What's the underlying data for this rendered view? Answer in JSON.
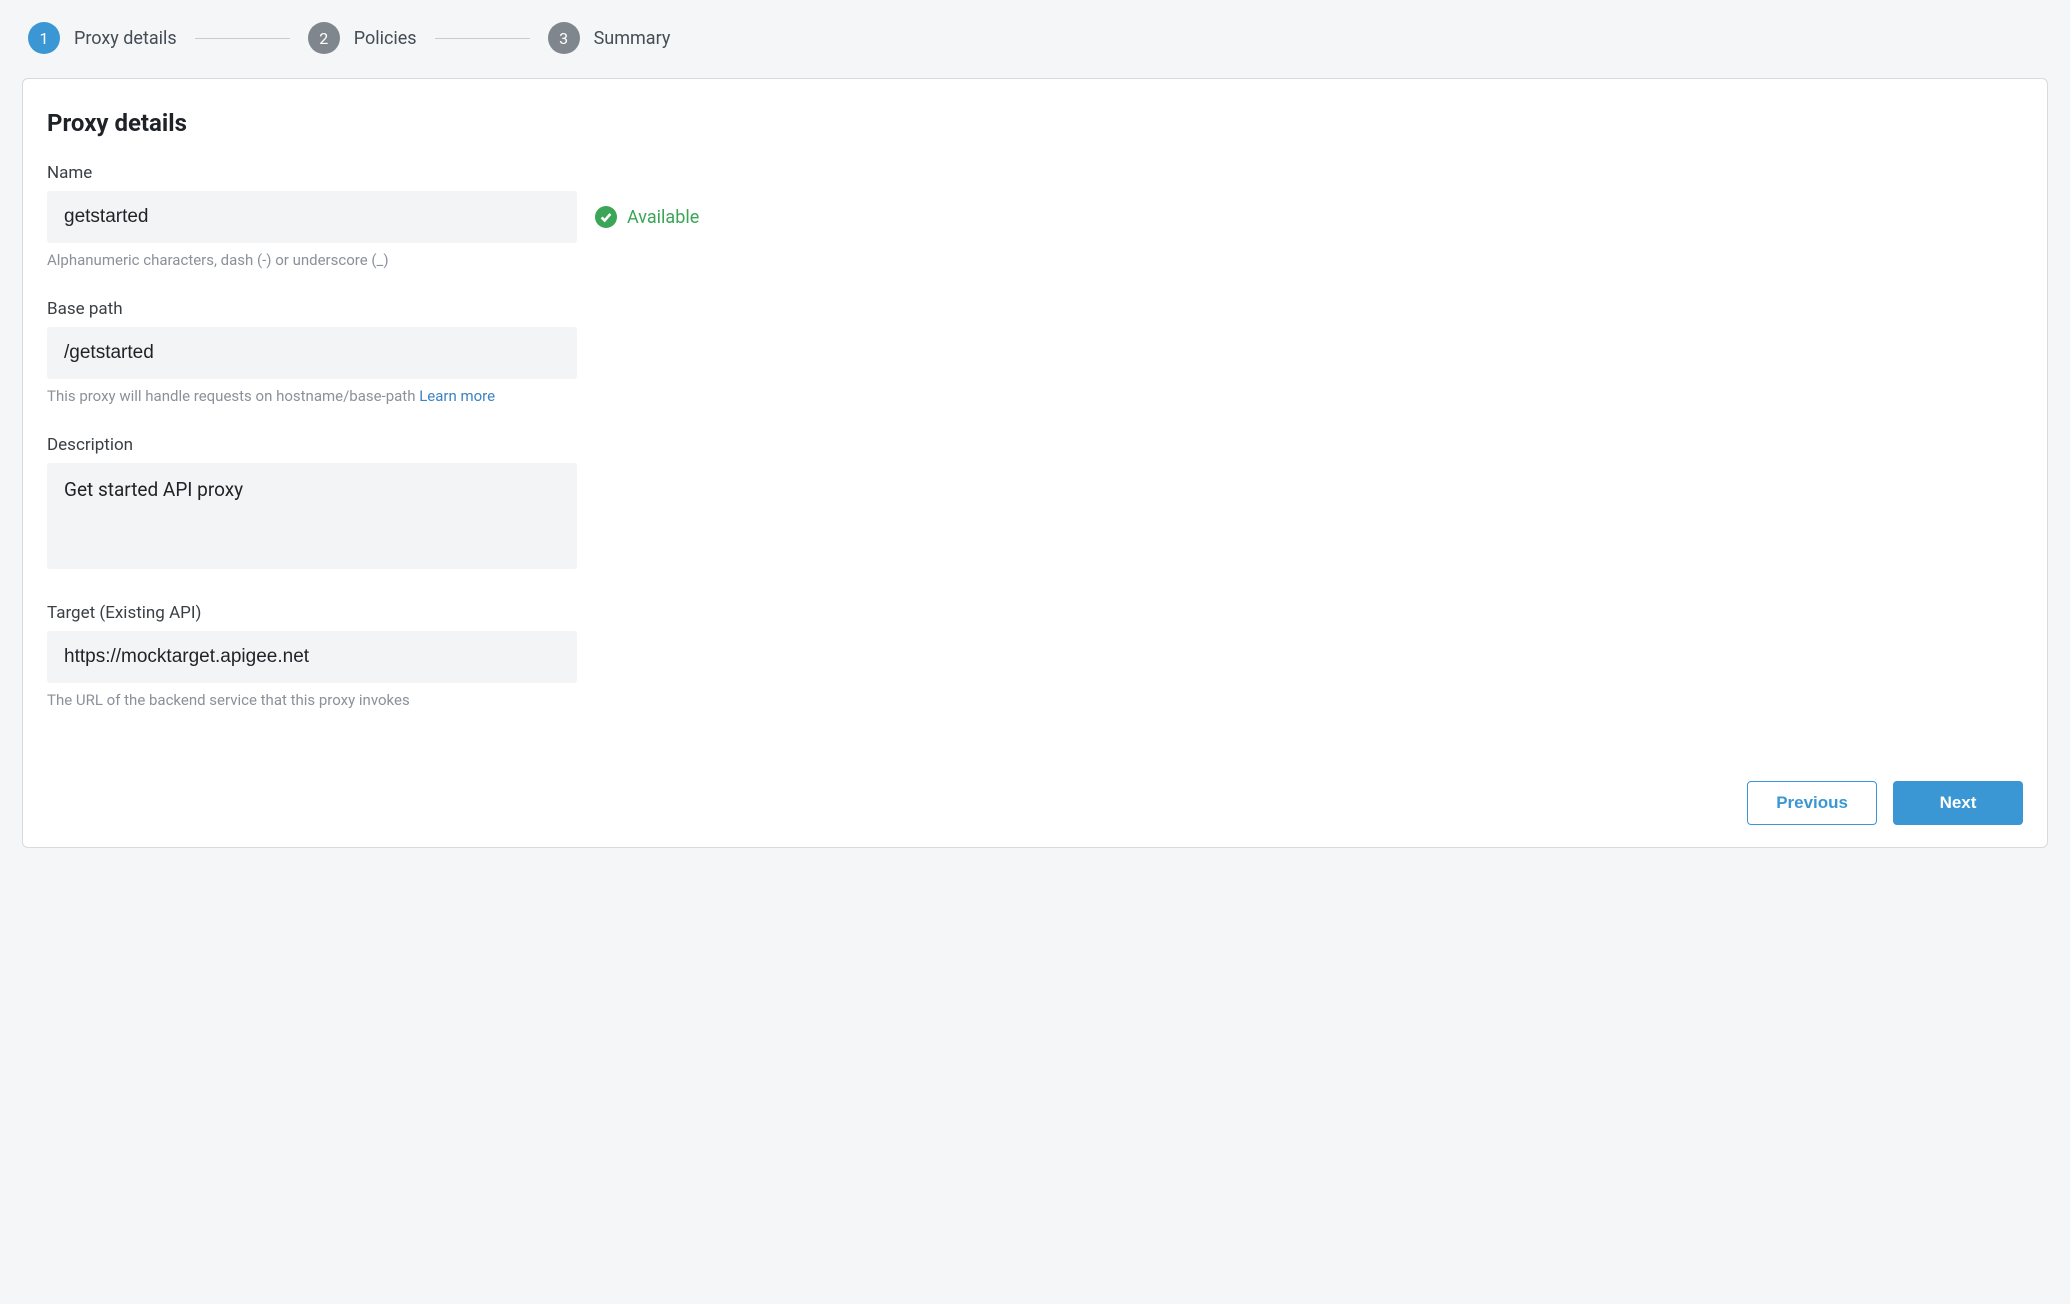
{
  "stepper": {
    "steps": [
      {
        "num": "1",
        "label": "Proxy details",
        "active": true
      },
      {
        "num": "2",
        "label": "Policies",
        "active": false
      },
      {
        "num": "3",
        "label": "Summary",
        "active": false
      }
    ]
  },
  "card": {
    "title": "Proxy details"
  },
  "fields": {
    "name": {
      "label": "Name",
      "value": "getstarted",
      "helper": "Alphanumeric characters, dash (-) or underscore (_)",
      "availability": "Available"
    },
    "basepath": {
      "label": "Base path",
      "value": "/getstarted",
      "helper_prefix": "This proxy will handle requests on hostname/base-path ",
      "helper_link": "Learn more"
    },
    "description": {
      "label": "Description",
      "value": "Get started API proxy"
    },
    "target": {
      "label": "Target (Existing API)",
      "value": "https://mocktarget.apigee.net",
      "helper": "The URL of the backend service that this proxy invokes"
    }
  },
  "footer": {
    "previous": "Previous",
    "next": "Next"
  }
}
